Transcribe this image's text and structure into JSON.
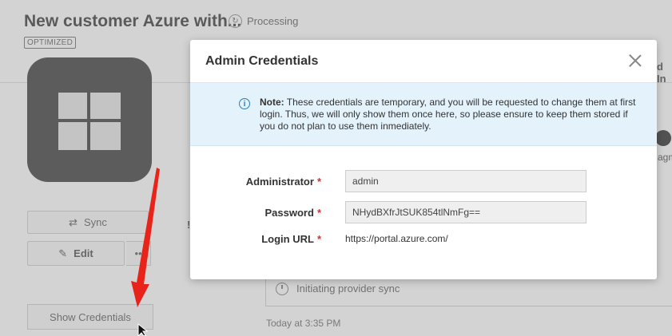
{
  "page": {
    "title": "New customer Azure with...",
    "status": "Processing",
    "badge": "OPTIMIZED"
  },
  "sidebar": {
    "sync_label": "Sync",
    "edit_label": "Edit",
    "more_label": "••",
    "show_credentials_label": "Show Credentials"
  },
  "background": {
    "tab_fragment": "d In",
    "right_fragment": "agm",
    "activity_text": "Initiating provider sync",
    "timestamp": "Today at 3:35 PM",
    "sidebar_fragment": "!"
  },
  "modal": {
    "title": "Admin Credentials",
    "note_prefix": "Note:",
    "note_text": "These credentials are temporary, and you will be requested to change them at first login. Thus, we will only show them once here, so please ensure to keep them stored if you do not plan to use them inmediately.",
    "fields": {
      "administrator_label": "Administrator",
      "administrator_value": "admin",
      "password_label": "Password",
      "password_value": "NHydBXfrJtSUK854tlNmFg==",
      "login_url_label": "Login URL",
      "login_url_value": "https://portal.azure.com/",
      "required_marker": "*"
    }
  },
  "colors": {
    "info_accent": "#2c7cb8",
    "note_background": "#e3f2fb",
    "required": "#d9302b",
    "annotation_arrow": "#e8231a"
  }
}
